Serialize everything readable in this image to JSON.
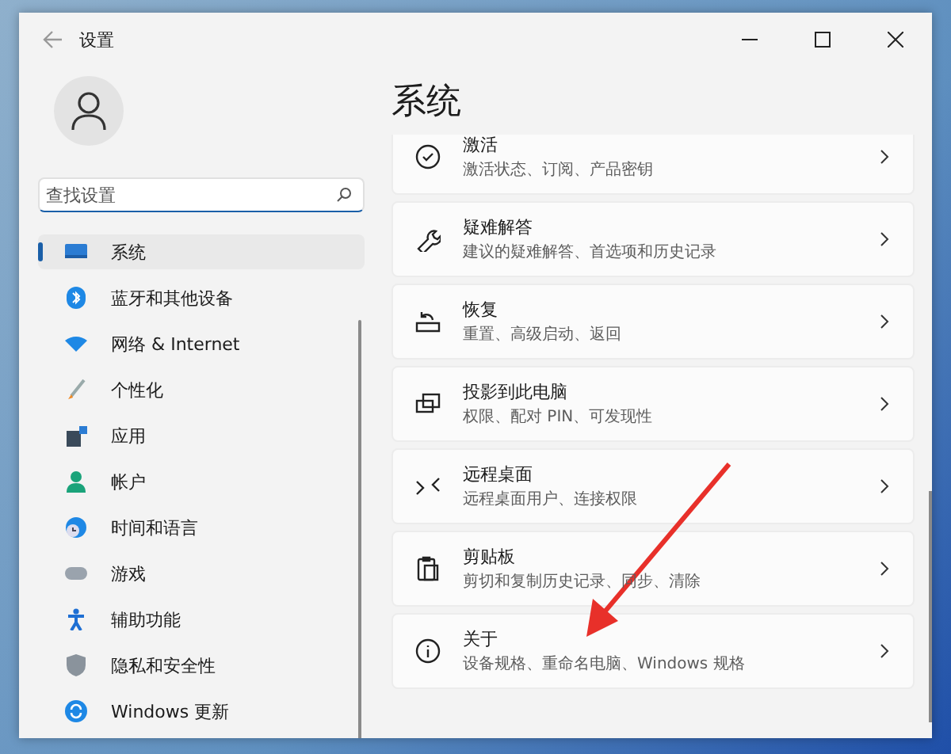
{
  "window": {
    "title": "设置"
  },
  "search": {
    "placeholder": "查找设置"
  },
  "nav_items": [
    {
      "label": "系统",
      "selected": true,
      "kind": "system"
    },
    {
      "label": "蓝牙和其他设备",
      "selected": false,
      "kind": "bluetooth"
    },
    {
      "label": "网络 & Internet",
      "selected": false,
      "kind": "network"
    },
    {
      "label": "个性化",
      "selected": false,
      "kind": "brush"
    },
    {
      "label": "应用",
      "selected": false,
      "kind": "apps"
    },
    {
      "label": "帐户",
      "selected": false,
      "kind": "account"
    },
    {
      "label": "时间和语言",
      "selected": false,
      "kind": "time"
    },
    {
      "label": "游戏",
      "selected": false,
      "kind": "game"
    },
    {
      "label": "辅助功能",
      "selected": false,
      "kind": "access"
    },
    {
      "label": "隐私和安全性",
      "selected": false,
      "kind": "shield"
    },
    {
      "label": "Windows 更新",
      "selected": false,
      "kind": "update"
    }
  ],
  "page_title": "系统",
  "cards": [
    {
      "title": "激活",
      "subtitle": "激活状态、订阅、产品密钥",
      "kind": "check"
    },
    {
      "title": "疑难解答",
      "subtitle": "建议的疑难解答、首选项和历史记录",
      "kind": "wrench"
    },
    {
      "title": "恢复",
      "subtitle": "重置、高级启动、返回",
      "kind": "recovery"
    },
    {
      "title": "投影到此电脑",
      "subtitle": "权限、配对 PIN、可发现性",
      "kind": "project"
    },
    {
      "title": "远程桌面",
      "subtitle": "远程桌面用户、连接权限",
      "kind": "remote"
    },
    {
      "title": "剪贴板",
      "subtitle": "剪切和复制历史记录、同步、清除",
      "kind": "clipboard"
    },
    {
      "title": "关于",
      "subtitle": "设备规格、重命名电脑、Windows 规格",
      "kind": "info"
    }
  ]
}
